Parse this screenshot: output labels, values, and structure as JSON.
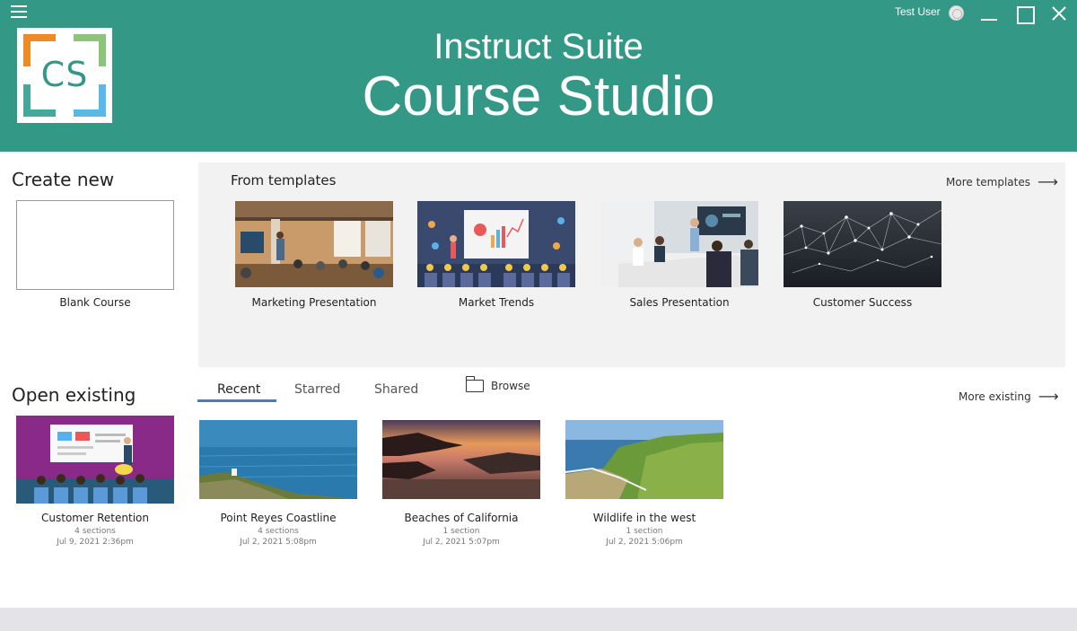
{
  "header": {
    "title_line1": "Instruct Suite",
    "title_line2": "Course Studio",
    "logo_text": "CS",
    "user_name": "Test User",
    "background": "#339886"
  },
  "create_new": {
    "heading": "Create new",
    "blank_label": "Blank Course"
  },
  "templates": {
    "heading": "From templates",
    "more_label": "More templates",
    "items": [
      {
        "label": "Marketing Presentation"
      },
      {
        "label": "Market Trends"
      },
      {
        "label": "Sales Presentation"
      },
      {
        "label": "Customer Success"
      }
    ]
  },
  "open_existing": {
    "heading": "Open existing",
    "tabs": [
      {
        "label": "Recent",
        "active": true
      },
      {
        "label": "Starred"
      },
      {
        "label": "Shared"
      }
    ],
    "browse_label": "Browse",
    "more_label": "More existing",
    "items": [
      {
        "label": "Customer Retention",
        "sections": "4 sections",
        "date": "Jul 9, 2021 2:36pm"
      },
      {
        "label": "Point Reyes Coastline",
        "sections": "4 sections",
        "date": "Jul 2, 2021 5:08pm"
      },
      {
        "label": "Beaches of California",
        "sections": "1 section",
        "date": "Jul 2, 2021 5:07pm"
      },
      {
        "label": "Wildlife in the west",
        "sections": "1 section",
        "date": "Jul 2, 2021 5:06pm"
      }
    ]
  },
  "colors": {
    "accent": "#339886",
    "tab_underline": "#3d7fcc"
  }
}
